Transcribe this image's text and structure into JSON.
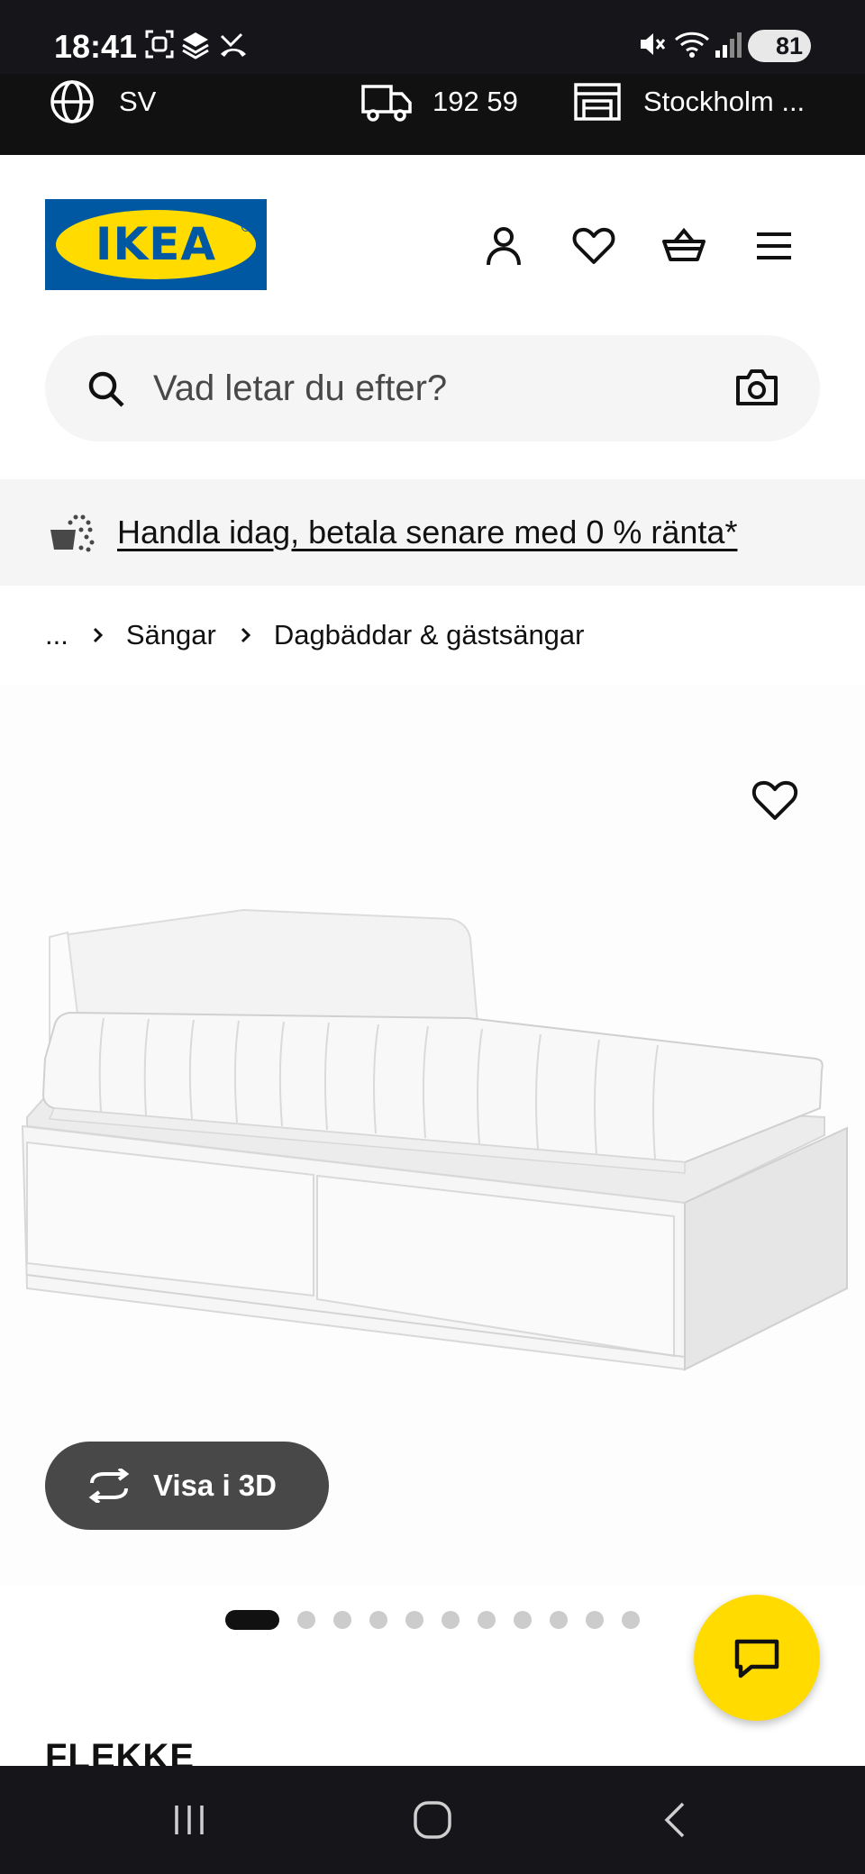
{
  "status_bar": {
    "time": "18:41",
    "battery": "81"
  },
  "top_strip": {
    "language": "SV",
    "postal_code": "192 59",
    "store": "Stockholm ..."
  },
  "header": {
    "logo_text": "IKEA",
    "icons": [
      "account-icon",
      "wishlist-icon",
      "cart-icon",
      "menu-icon"
    ]
  },
  "search": {
    "placeholder": "Vad letar du efter?"
  },
  "promo": {
    "text": "Handla idag, betala senare med 0 % ränta*"
  },
  "breadcrumb": {
    "ellipsis": "...",
    "items": [
      "Sängar",
      "Dagbäddar & gästsängar"
    ]
  },
  "product": {
    "view_3d_label": "Visa i 3D",
    "name": "FLEKKE",
    "carousel": {
      "total": 12,
      "active": 1
    }
  },
  "colors": {
    "brand_blue": "#0058a3",
    "brand_yellow": "#ffdb00",
    "dark": "#111111"
  }
}
